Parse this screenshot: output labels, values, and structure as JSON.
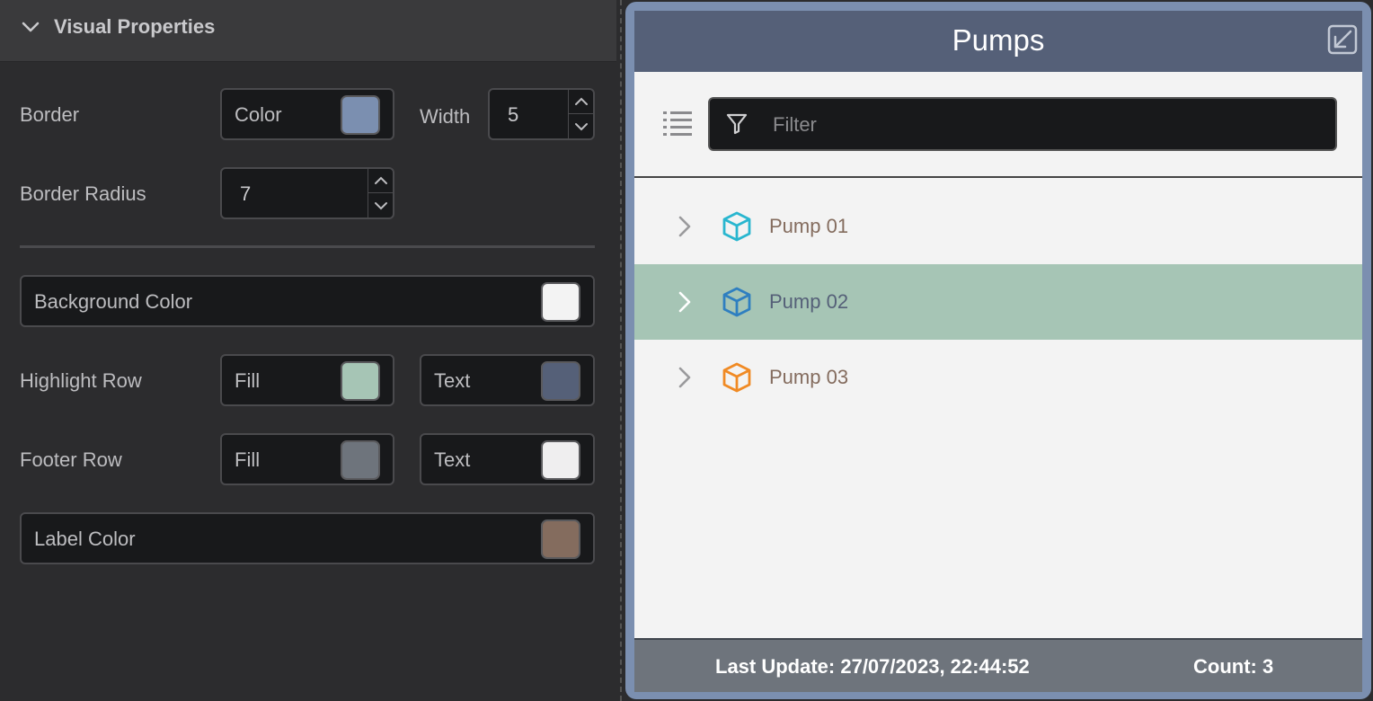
{
  "panel": {
    "section_title": "Visual Properties",
    "border": {
      "label": "Border",
      "color_label": "Color",
      "color": "#7b8fb0",
      "width_label": "Width",
      "width_value": "5"
    },
    "border_radius": {
      "label": "Border Radius",
      "value": "7"
    },
    "background_color": {
      "label": "Background Color",
      "color": "#f3f3f3"
    },
    "highlight_row": {
      "label": "Highlight Row",
      "fill_label": "Fill",
      "fill_color": "#a6c5b5",
      "text_label": "Text",
      "text_color": "#556078"
    },
    "footer_row": {
      "label": "Footer Row",
      "fill_label": "Fill",
      "fill_color": "#6e747c",
      "text_label": "Text",
      "text_color": "#efeeef"
    },
    "label_color": {
      "label": "Label Color",
      "color": "#846c5e"
    }
  },
  "widget": {
    "title": "Pumps",
    "filter_placeholder": "Filter",
    "rows": [
      {
        "name": "Pump 01",
        "icon": "cube-icon",
        "icon_color": "#29b6cf",
        "highlighted": false
      },
      {
        "name": "Pump 02",
        "icon": "cube-icon",
        "icon_color": "#2f7fc0",
        "highlighted": true
      },
      {
        "name": "Pump 03",
        "icon": "cube-icon",
        "icon_color": "#f08a24",
        "highlighted": false
      }
    ],
    "footer": {
      "last_update": "Last Update: 27/07/2023, 22:44:52",
      "count": "Count: 3"
    }
  }
}
